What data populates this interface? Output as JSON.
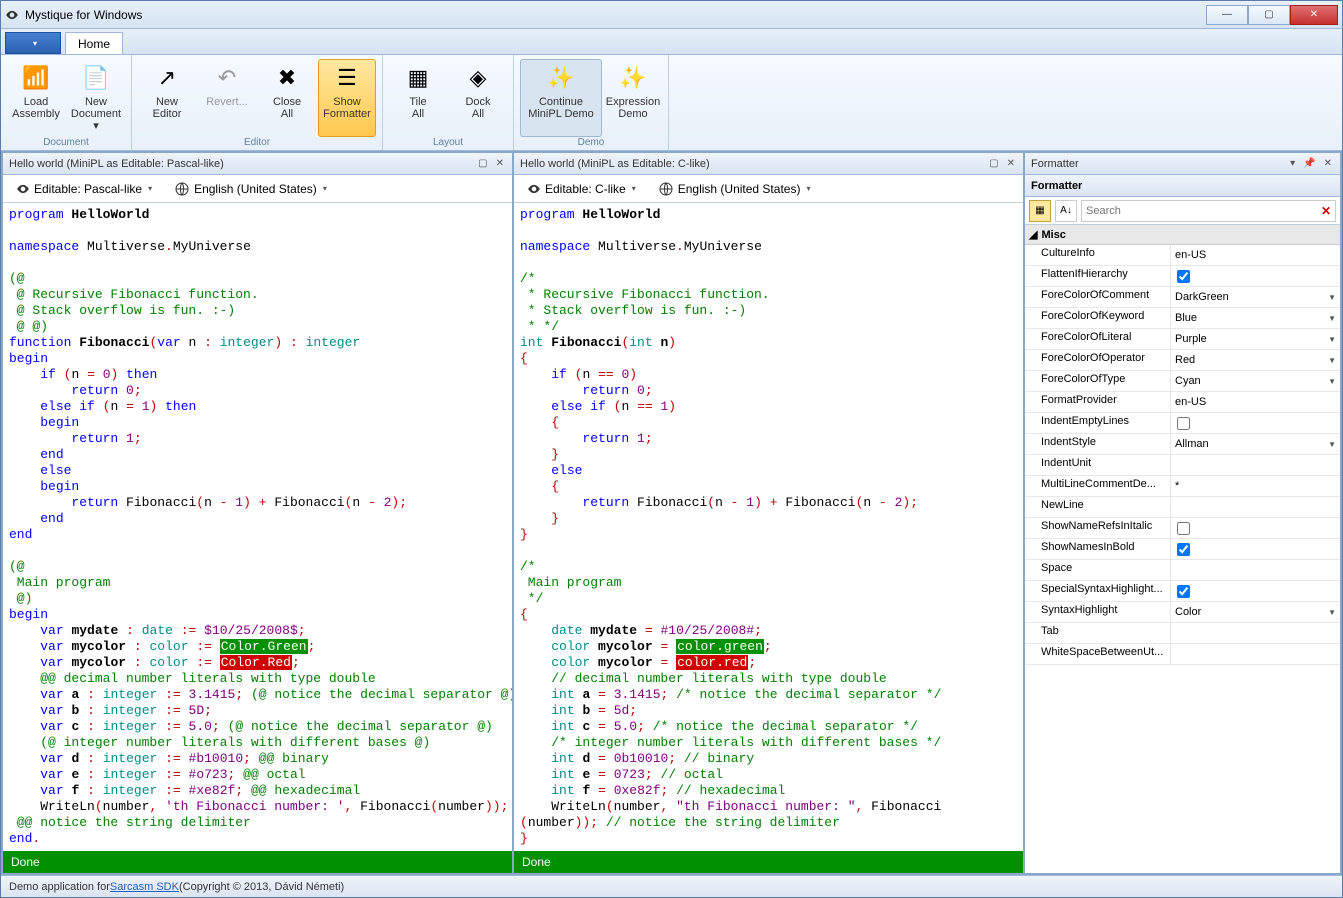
{
  "window": {
    "title": "Mystique for Windows"
  },
  "tabs": {
    "home": "Home"
  },
  "ribbon": {
    "groups": [
      {
        "label": "Document",
        "items": [
          {
            "name": "load-assembly",
            "label": "Load\nAssembly",
            "icon": "📶"
          },
          {
            "name": "new-document",
            "label": "New\nDocument ▾",
            "icon": "📄"
          }
        ]
      },
      {
        "label": "Editor",
        "items": [
          {
            "name": "new-editor",
            "label": "New\nEditor",
            "icon": "↗"
          },
          {
            "name": "revert",
            "label": "Revert...",
            "icon": "↶",
            "disabled": true
          },
          {
            "name": "close-all",
            "label": "Close\nAll",
            "icon": "✖"
          },
          {
            "name": "show-formatter",
            "label": "Show\nFormatter",
            "icon": "☰",
            "active": true
          }
        ]
      },
      {
        "label": "Layout",
        "items": [
          {
            "name": "tile-all",
            "label": "Tile\nAll",
            "icon": "▦"
          },
          {
            "name": "dock-all",
            "label": "Dock\nAll",
            "icon": "◈"
          }
        ]
      },
      {
        "label": "Demo",
        "items": [
          {
            "name": "continue-demo",
            "label": "Continue\nMiniPL Demo",
            "icon": "✨",
            "highlight": true,
            "wide": true
          },
          {
            "name": "expression-demo",
            "label": "Expression\nDemo",
            "icon": "✨"
          }
        ]
      }
    ]
  },
  "editors": [
    {
      "title": "Hello world (MiniPL as Editable: Pascal-like)",
      "lang": "Editable: Pascal-like",
      "culture": "English (United States)",
      "status": "Done",
      "code_id": "pascal"
    },
    {
      "title": "Hello world (MiniPL as Editable: C-like)",
      "lang": "Editable: C-like",
      "culture": "English (United States)",
      "status": "Done",
      "code_id": "clike"
    }
  ],
  "formatter": {
    "title": "Formatter",
    "subtitle": "Formatter",
    "search_placeholder": "Search",
    "section": "Misc",
    "props": [
      {
        "k": "CultureInfo",
        "v": "en-US"
      },
      {
        "k": "FlattenIfHierarchy",
        "v": true,
        "type": "check"
      },
      {
        "k": "ForeColorOfComment",
        "v": "DarkGreen",
        "type": "combo"
      },
      {
        "k": "ForeColorOfKeyword",
        "v": "Blue",
        "type": "combo"
      },
      {
        "k": "ForeColorOfLiteral",
        "v": "Purple",
        "type": "combo"
      },
      {
        "k": "ForeColorOfOperator",
        "v": "Red",
        "type": "combo"
      },
      {
        "k": "ForeColorOfType",
        "v": "Cyan",
        "type": "combo"
      },
      {
        "k": "FormatProvider",
        "v": "en-US"
      },
      {
        "k": "IndentEmptyLines",
        "v": false,
        "type": "check"
      },
      {
        "k": "IndentStyle",
        "v": "Allman",
        "type": "combo"
      },
      {
        "k": "IndentUnit",
        "v": ""
      },
      {
        "k": "MultiLineCommentDe...",
        "v": "*"
      },
      {
        "k": "NewLine",
        "v": ""
      },
      {
        "k": "ShowNameRefsInItalic",
        "v": false,
        "type": "check"
      },
      {
        "k": "ShowNamesInBold",
        "v": true,
        "type": "check"
      },
      {
        "k": "Space",
        "v": ""
      },
      {
        "k": "SpecialSyntaxHighlight...",
        "v": true,
        "type": "check"
      },
      {
        "k": "SyntaxHighlight",
        "v": "Color",
        "type": "combo"
      },
      {
        "k": "Tab",
        "v": ""
      },
      {
        "k": "WhiteSpaceBetweenUt...",
        "v": ""
      }
    ]
  },
  "footer": {
    "text": "Demo application for ",
    "link": "Sarcasm SDK",
    "copyright": "  (Copyright © 2013, Dávid Németi)"
  }
}
